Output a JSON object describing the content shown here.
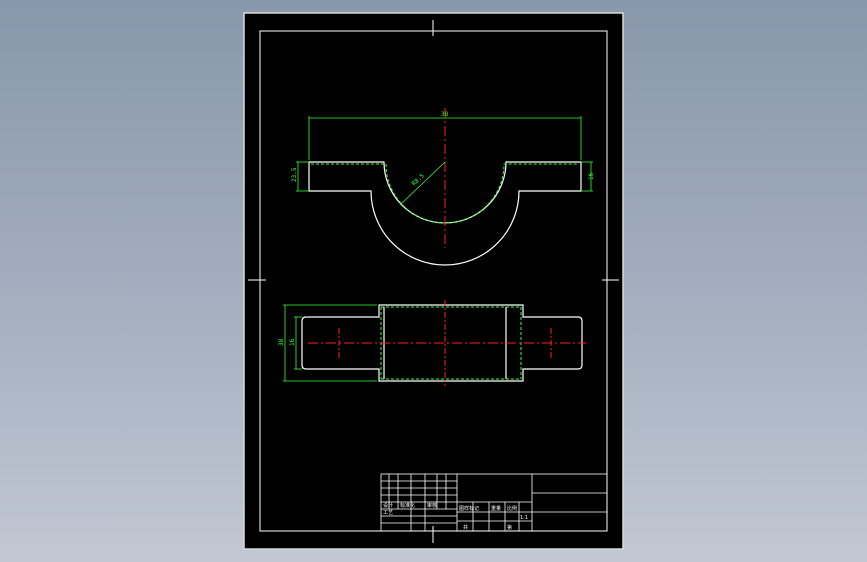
{
  "drawing": {
    "top_view": {
      "width_dim": "38",
      "left_height_dim": "23.5",
      "right_height_dim": "16",
      "radius_dim": "R8.5"
    },
    "front_view": {
      "outer_height_dim": "38",
      "inner_height_dim": "16"
    },
    "title_block": {
      "row_label_1": "设计",
      "row_label_2": "标准化",
      "row_label_3": "审核",
      "row_label_4": "工艺",
      "part_label": "图样标记",
      "weight_label": "重量",
      "scale_label": "比例",
      "scale_value": "1:1",
      "sheet_label": "共",
      "sheet_label_2": "第"
    }
  },
  "colors": {
    "paper": "#000000",
    "frame": "#ffffff",
    "outline": "#ffffff",
    "hidden": "#33ff33",
    "centerline": "#ff2020",
    "dimension": "#33ff33"
  }
}
